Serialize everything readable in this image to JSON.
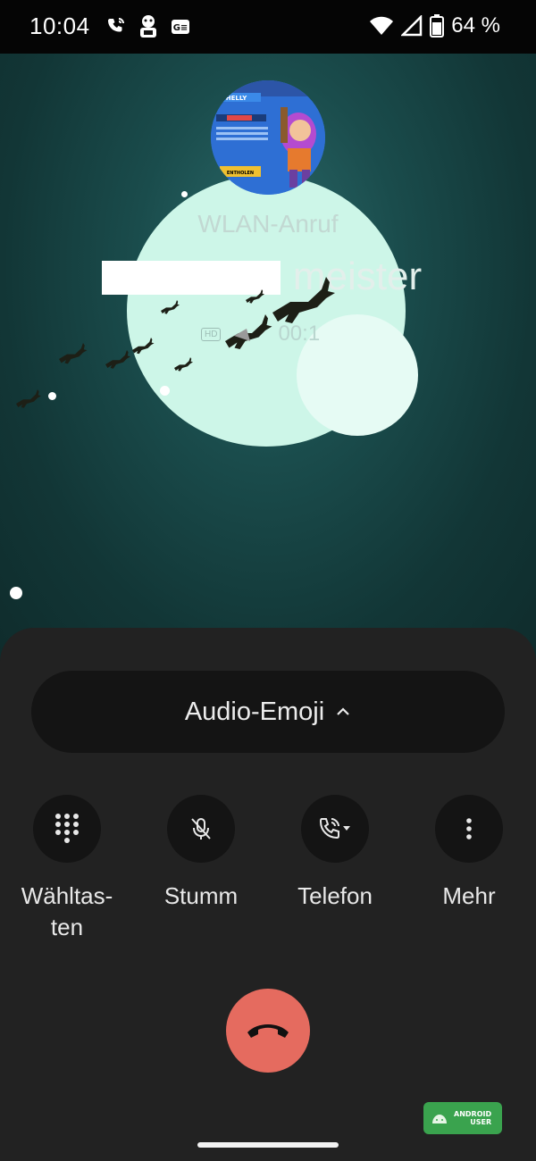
{
  "status_bar": {
    "time": "10:04",
    "battery_percent": "64 %",
    "icons": [
      "wifi-call-icon",
      "mascot-notification-icon",
      "ge-notification-icon",
      "wifi-icon",
      "signal-icon",
      "battery-icon"
    ]
  },
  "call": {
    "type_label": "WLAN-Anruf",
    "caller_name_visible": "meister",
    "duration": "00:1",
    "hd_badge": "HD",
    "avatar_texts": [
      "SHELLY",
      "ENTHOLEN"
    ]
  },
  "audio_emoji": {
    "label": "Audio-Emoji"
  },
  "controls": [
    {
      "label": "Wähltas-\nten",
      "icon": "dialpad-icon"
    },
    {
      "label": "Stumm",
      "icon": "mute-icon"
    },
    {
      "label": "Telefon",
      "icon": "phone-audio-route-icon"
    },
    {
      "label": "Mehr",
      "icon": "more-vert-icon"
    }
  ],
  "watermark": {
    "line1": "ANDROID",
    "line2": "USER"
  },
  "colors": {
    "end_call": "#e56b5f",
    "panel": "#222222",
    "button_bg": "#141414",
    "moon": "#cdf6e8",
    "watermark": "#3aa34e"
  }
}
